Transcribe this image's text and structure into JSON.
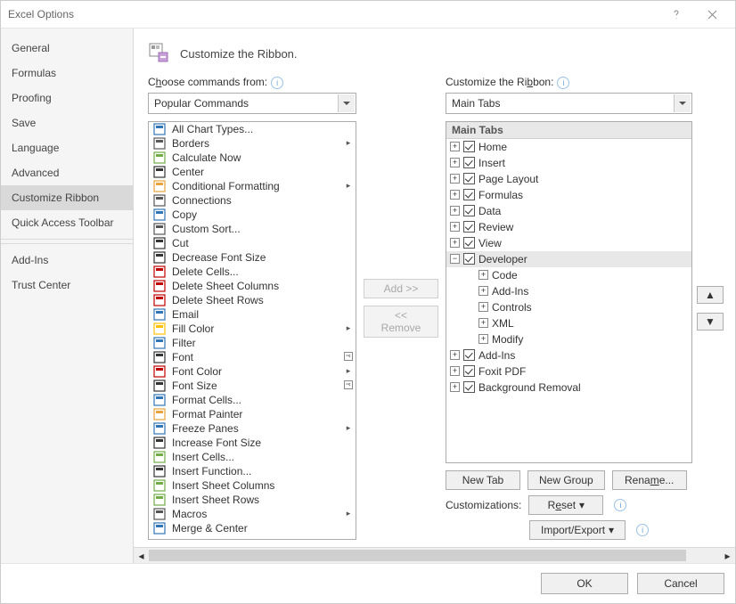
{
  "window": {
    "title": "Excel Options"
  },
  "sidebar": {
    "items": [
      "General",
      "Formulas",
      "Proofing",
      "Save",
      "Language",
      "Advanced",
      "Customize Ribbon",
      "Quick Access Toolbar",
      "Add-Ins",
      "Trust Center"
    ],
    "selected_index": 6
  },
  "header": {
    "text": "Customize the Ribbon."
  },
  "left": {
    "label_pre": "C",
    "label_ul": "h",
    "label_post": "oose commands from:",
    "combo_value": "Popular Commands",
    "commands": [
      {
        "label": "All Chart Types...",
        "flyout": false
      },
      {
        "label": "Borders",
        "flyout": true
      },
      {
        "label": "Calculate Now",
        "flyout": false
      },
      {
        "label": "Center",
        "flyout": false
      },
      {
        "label": "Conditional Formatting",
        "flyout": true
      },
      {
        "label": "Connections",
        "flyout": false
      },
      {
        "label": "Copy",
        "flyout": false
      },
      {
        "label": "Custom Sort...",
        "flyout": false
      },
      {
        "label": "Cut",
        "flyout": false
      },
      {
        "label": "Decrease Font Size",
        "flyout": false
      },
      {
        "label": "Delete Cells...",
        "flyout": false
      },
      {
        "label": "Delete Sheet Columns",
        "flyout": false
      },
      {
        "label": "Delete Sheet Rows",
        "flyout": false
      },
      {
        "label": "Email",
        "flyout": false
      },
      {
        "label": "Fill Color",
        "flyout": true
      },
      {
        "label": "Filter",
        "flyout": false
      },
      {
        "label": "Font",
        "flyout": false,
        "right": "combo"
      },
      {
        "label": "Font Color",
        "flyout": true
      },
      {
        "label": "Font Size",
        "flyout": false,
        "right": "combo"
      },
      {
        "label": "Format Cells...",
        "flyout": false
      },
      {
        "label": "Format Painter",
        "flyout": false
      },
      {
        "label": "Freeze Panes",
        "flyout": true
      },
      {
        "label": "Increase Font Size",
        "flyout": false
      },
      {
        "label": "Insert Cells...",
        "flyout": false
      },
      {
        "label": "Insert Function...",
        "flyout": false
      },
      {
        "label": "Insert Sheet Columns",
        "flyout": false
      },
      {
        "label": "Insert Sheet Rows",
        "flyout": false
      },
      {
        "label": "Macros",
        "flyout": true
      },
      {
        "label": "Merge & Center",
        "flyout": false
      }
    ]
  },
  "mid": {
    "add": "Add >>",
    "remove": "<< Remove"
  },
  "right": {
    "label_pre": "Customize the Ri",
    "label_ul": "b",
    "label_post": "bon:",
    "combo_value": "Main Tabs",
    "tree_header": "Main Tabs",
    "tabs": [
      {
        "label": "Home",
        "checked": true,
        "expanded": false,
        "depth": 0
      },
      {
        "label": "Insert",
        "checked": true,
        "expanded": false,
        "depth": 0
      },
      {
        "label": "Page Layout",
        "checked": true,
        "expanded": false,
        "depth": 0
      },
      {
        "label": "Formulas",
        "checked": true,
        "expanded": false,
        "depth": 0
      },
      {
        "label": "Data",
        "checked": true,
        "expanded": false,
        "depth": 0
      },
      {
        "label": "Review",
        "checked": true,
        "expanded": false,
        "depth": 0
      },
      {
        "label": "View",
        "checked": true,
        "expanded": false,
        "depth": 0
      },
      {
        "label": "Developer",
        "checked": true,
        "expanded": true,
        "depth": 0,
        "selected": true
      },
      {
        "label": "Code",
        "depth": 1,
        "expanded": false,
        "nocheck": true
      },
      {
        "label": "Add-Ins",
        "depth": 1,
        "expanded": false,
        "nocheck": true
      },
      {
        "label": "Controls",
        "depth": 1,
        "expanded": false,
        "nocheck": true
      },
      {
        "label": "XML",
        "depth": 1,
        "expanded": false,
        "nocheck": true
      },
      {
        "label": "Modify",
        "depth": 1,
        "expanded": false,
        "nocheck": true
      },
      {
        "label": "Add-Ins",
        "checked": true,
        "expanded": false,
        "depth": 0
      },
      {
        "label": "Foxit PDF",
        "checked": true,
        "expanded": false,
        "depth": 0
      },
      {
        "label": "Background Removal",
        "checked": true,
        "expanded": false,
        "depth": 0
      }
    ],
    "buttons": {
      "new_tab": "New Tab",
      "new_group": "New Group",
      "rename": "Rename..."
    },
    "customizations_label": "Customizations:",
    "reset": "Reset",
    "import_export": "Import/Export"
  },
  "footer": {
    "ok": "OK",
    "cancel": "Cancel"
  },
  "glyph": {
    "plus": "+",
    "minus": "−",
    "tri_right": "▸",
    "collapse": "⊟",
    "expand": "⊞",
    "info": "i",
    "scroll_left": "◂",
    "scroll_right": "▸"
  }
}
